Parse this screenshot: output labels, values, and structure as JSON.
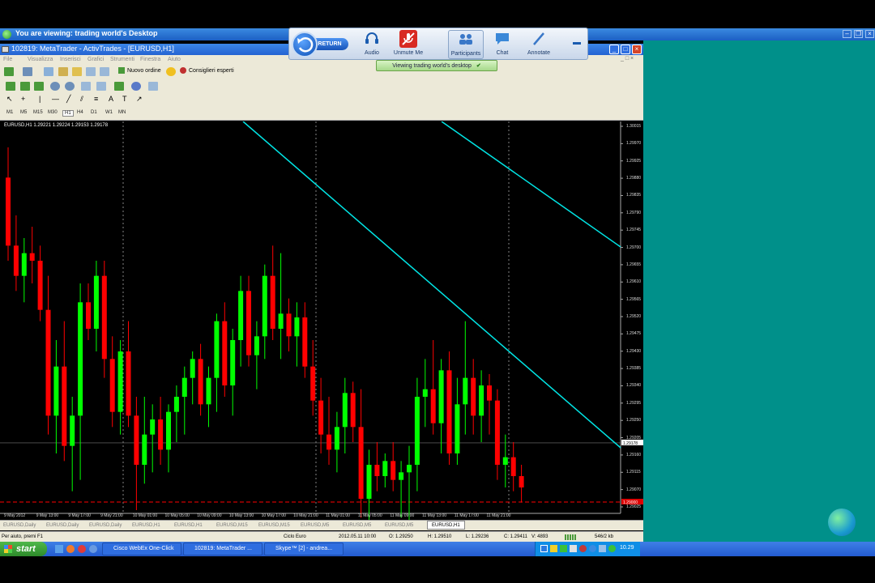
{
  "viewer": {
    "title": "You are viewing: trading world's Desktop",
    "banner": "Viewing trading world's desktop"
  },
  "webex": {
    "return_label": "RETURN",
    "buttons": [
      {
        "label": "Audio",
        "icon": "headset-icon"
      },
      {
        "label": "Unmute Me",
        "icon": "microphone-muted-icon"
      },
      {
        "label": "Participants",
        "icon": "participants-icon"
      },
      {
        "label": "Chat",
        "icon": "chat-icon"
      },
      {
        "label": "Annotate",
        "icon": "pen-icon"
      }
    ]
  },
  "window": {
    "title": "102819: MetaTrader - ActivTrades - [EURUSD,H1]"
  },
  "menu": [
    "File",
    "Visualizza",
    "Inserisci",
    "Grafici",
    "Strumenti",
    "Finestra",
    "Aiuto"
  ],
  "toolbar": {
    "new_order": "Nuovo ordine",
    "experts": "Consiglieri esperti"
  },
  "timeframes": [
    "M1",
    "M5",
    "M15",
    "M30",
    "H1",
    "H4",
    "D1",
    "W1",
    "MN"
  ],
  "chart_header": "EURUSD,H1  1.29221 1.29224 1.29153 1.29178",
  "chart_data": {
    "type": "candlestick",
    "symbol": "EURUSD",
    "timeframe": "H1",
    "y_ticks": [
      "1.30015",
      "1.29970",
      "1.29925",
      "1.29880",
      "1.29835",
      "1.29790",
      "1.29745",
      "1.29700",
      "1.29655",
      "1.29610",
      "1.29565",
      "1.29520",
      "1.29475",
      "1.29430",
      "1.29385",
      "1.29340",
      "1.29295",
      "1.29250",
      "1.29205",
      "1.29160",
      "1.29115",
      "1.29070",
      "1.29025"
    ],
    "ylim": [
      1.29,
      1.3002
    ],
    "current_price": "1.29178",
    "ask_price": "1.29000",
    "x_ticks": [
      "9 May 2012",
      "9 May 13:00",
      "9 May 17:00",
      "9 May 21:00",
      "10 May 01:00",
      "10 May 05:00",
      "10 May 09:00",
      "10 May 13:00",
      "10 May 17:00",
      "10 May 21:00",
      "11 May 01:00",
      "11 May 05:00",
      "11 May 09:00",
      "11 May 13:00",
      "11 May 17:00",
      "11 May 21:00"
    ],
    "candles": [
      {
        "o": 1.2988,
        "h": 1.2996,
        "l": 1.2966,
        "c": 1.297
      },
      {
        "o": 1.297,
        "h": 1.2978,
        "l": 1.2958,
        "c": 1.2962
      },
      {
        "o": 1.2962,
        "h": 1.2972,
        "l": 1.2955,
        "c": 1.2968
      },
      {
        "o": 1.2968,
        "h": 1.2975,
        "l": 1.296,
        "c": 1.2966
      },
      {
        "o": 1.2966,
        "h": 1.297,
        "l": 1.295,
        "c": 1.2953
      },
      {
        "o": 1.2953,
        "h": 1.2962,
        "l": 1.292,
        "c": 1.2925
      },
      {
        "o": 1.2925,
        "h": 1.2945,
        "l": 1.2915,
        "c": 1.2938
      },
      {
        "o": 1.2938,
        "h": 1.295,
        "l": 1.2913,
        "c": 1.2917
      },
      {
        "o": 1.2917,
        "h": 1.293,
        "l": 1.2905,
        "c": 1.2925
      },
      {
        "o": 1.2925,
        "h": 1.296,
        "l": 1.2908,
        "c": 1.2955
      },
      {
        "o": 1.2955,
        "h": 1.296,
        "l": 1.2945,
        "c": 1.2948
      },
      {
        "o": 1.2948,
        "h": 1.2966,
        "l": 1.2942,
        "c": 1.2962
      },
      {
        "o": 1.2962,
        "h": 1.2966,
        "l": 1.2935,
        "c": 1.294
      },
      {
        "o": 1.294,
        "h": 1.2946,
        "l": 1.2922,
        "c": 1.2926
      },
      {
        "o": 1.2926,
        "h": 1.2945,
        "l": 1.292,
        "c": 1.2942
      },
      {
        "o": 1.2942,
        "h": 1.295,
        "l": 1.2922,
        "c": 1.2925
      },
      {
        "o": 1.2925,
        "h": 1.293,
        "l": 1.29,
        "c": 1.2912
      },
      {
        "o": 1.2912,
        "h": 1.293,
        "l": 1.2907,
        "c": 1.292
      },
      {
        "o": 1.292,
        "h": 1.2928,
        "l": 1.291,
        "c": 1.2924
      },
      {
        "o": 1.2924,
        "h": 1.293,
        "l": 1.2912,
        "c": 1.2916
      },
      {
        "o": 1.2916,
        "h": 1.2928,
        "l": 1.291,
        "c": 1.2926
      },
      {
        "o": 1.2926,
        "h": 1.2933,
        "l": 1.2918,
        "c": 1.293
      },
      {
        "o": 1.293,
        "h": 1.2938,
        "l": 1.292,
        "c": 1.2935
      },
      {
        "o": 1.2935,
        "h": 1.2942,
        "l": 1.2928,
        "c": 1.294
      },
      {
        "o": 1.294,
        "h": 1.2944,
        "l": 1.2925,
        "c": 1.2928
      },
      {
        "o": 1.2928,
        "h": 1.2938,
        "l": 1.2922,
        "c": 1.2935
      },
      {
        "o": 1.2935,
        "h": 1.2952,
        "l": 1.2926,
        "c": 1.295
      },
      {
        "o": 1.295,
        "h": 1.2955,
        "l": 1.293,
        "c": 1.2933
      },
      {
        "o": 1.2933,
        "h": 1.2948,
        "l": 1.2925,
        "c": 1.2945
      },
      {
        "o": 1.2945,
        "h": 1.2962,
        "l": 1.2938,
        "c": 1.2958
      },
      {
        "o": 1.2958,
        "h": 1.2962,
        "l": 1.2938,
        "c": 1.2941
      },
      {
        "o": 1.2941,
        "h": 1.295,
        "l": 1.2932,
        "c": 1.2946
      },
      {
        "o": 1.2946,
        "h": 1.2965,
        "l": 1.294,
        "c": 1.2962
      },
      {
        "o": 1.2962,
        "h": 1.297,
        "l": 1.2945,
        "c": 1.2948
      },
      {
        "o": 1.2948,
        "h": 1.2968,
        "l": 1.294,
        "c": 1.2952
      },
      {
        "o": 1.2952,
        "h": 1.2956,
        "l": 1.2942,
        "c": 1.2946
      },
      {
        "o": 1.2946,
        "h": 1.2955,
        "l": 1.2938,
        "c": 1.2951
      },
      {
        "o": 1.2951,
        "h": 1.2955,
        "l": 1.2935,
        "c": 1.2938
      },
      {
        "o": 1.2938,
        "h": 1.2945,
        "l": 1.2925,
        "c": 1.2929
      },
      {
        "o": 1.2929,
        "h": 1.2935,
        "l": 1.2915,
        "c": 1.292
      },
      {
        "o": 1.292,
        "h": 1.293,
        "l": 1.2912,
        "c": 1.2916
      },
      {
        "o": 1.2916,
        "h": 1.2926,
        "l": 1.291,
        "c": 1.2922
      },
      {
        "o": 1.2922,
        "h": 1.2935,
        "l": 1.2915,
        "c": 1.2931
      },
      {
        "o": 1.2931,
        "h": 1.2934,
        "l": 1.2918,
        "c": 1.2922
      },
      {
        "o": 1.2922,
        "h": 1.2932,
        "l": 1.2898,
        "c": 1.2903
      },
      {
        "o": 1.2903,
        "h": 1.2916,
        "l": 1.2897,
        "c": 1.2912
      },
      {
        "o": 1.2912,
        "h": 1.2918,
        "l": 1.2905,
        "c": 1.2909
      },
      {
        "o": 1.2909,
        "h": 1.2915,
        "l": 1.2906,
        "c": 1.2913
      },
      {
        "o": 1.2913,
        "h": 1.2918,
        "l": 1.2905,
        "c": 1.2908
      },
      {
        "o": 1.2908,
        "h": 1.2913,
        "l": 1.2898,
        "c": 1.291
      },
      {
        "o": 1.291,
        "h": 1.2917,
        "l": 1.2897,
        "c": 1.2912
      },
      {
        "o": 1.2912,
        "h": 1.2935,
        "l": 1.2905,
        "c": 1.293
      },
      {
        "o": 1.293,
        "h": 1.294,
        "l": 1.2922,
        "c": 1.2932
      },
      {
        "o": 1.2932,
        "h": 1.2945,
        "l": 1.292,
        "c": 1.2923
      },
      {
        "o": 1.2923,
        "h": 1.294,
        "l": 1.2915,
        "c": 1.2937
      },
      {
        "o": 1.2937,
        "h": 1.2942,
        "l": 1.2912,
        "c": 1.2915
      },
      {
        "o": 1.2915,
        "h": 1.2935,
        "l": 1.2912,
        "c": 1.2928
      },
      {
        "o": 1.2928,
        "h": 1.295,
        "l": 1.292,
        "c": 1.2935
      },
      {
        "o": 1.2935,
        "h": 1.294,
        "l": 1.292,
        "c": 1.2925
      },
      {
        "o": 1.2925,
        "h": 1.2937,
        "l": 1.2918,
        "c": 1.2933
      },
      {
        "o": 1.2933,
        "h": 1.2936,
        "l": 1.292,
        "c": 1.2929
      },
      {
        "o": 1.2929,
        "h": 1.2932,
        "l": 1.2908,
        "c": 1.2912
      },
      {
        "o": 1.2912,
        "h": 1.292,
        "l": 1.2906,
        "c": 1.2914
      },
      {
        "o": 1.2914,
        "h": 1.2918,
        "l": 1.2905,
        "c": 1.2909
      },
      {
        "o": 1.2909,
        "h": 1.2912,
        "l": 1.2902,
        "c": 1.2906
      }
    ],
    "trendlines": [
      {
        "from": [
          "9 May 21:00",
          1.3002
        ],
        "to": [
          "11 May 21:00+",
          1.2917
        ]
      },
      {
        "from": [
          "11 May 05:00",
          1.3002
        ],
        "to": [
          "11 May 21:00+",
          1.297
        ]
      }
    ]
  },
  "tabs": [
    "EURUSD,Daily",
    "EURUSD,Daily",
    "EURUSD,Daily",
    "EURUSD,H1",
    "EURUSD,H1",
    "EURUSD,M15",
    "EURUSD,M15",
    "EURUSD,M5",
    "EURUSD,M5",
    "EURUSD,M5",
    "EURUSD,H1"
  ],
  "active_tab_index": 10,
  "status": {
    "help": "Per aiuto, premi F1",
    "profile": "Ciclo Euro",
    "datetime": "2012.05.11 10:00",
    "open": "O: 1.29250",
    "high": "H: 1.29510",
    "low": "L: 1.29236",
    "close": "C: 1.29411",
    "volume": "V: 4893",
    "traffic": "546/2 kb"
  },
  "taskbar": {
    "start": "start",
    "tasks": [
      "Cisco WebEx One-Click",
      "102819: MetaTrader ...",
      "Skype™ [2] - andrea..."
    ],
    "clock": "10.29"
  },
  "colors": {
    "bull": "#00ff00",
    "bear": "#ff0000",
    "trendline": "#00e5e5",
    "ask_line": "#ff0000"
  }
}
